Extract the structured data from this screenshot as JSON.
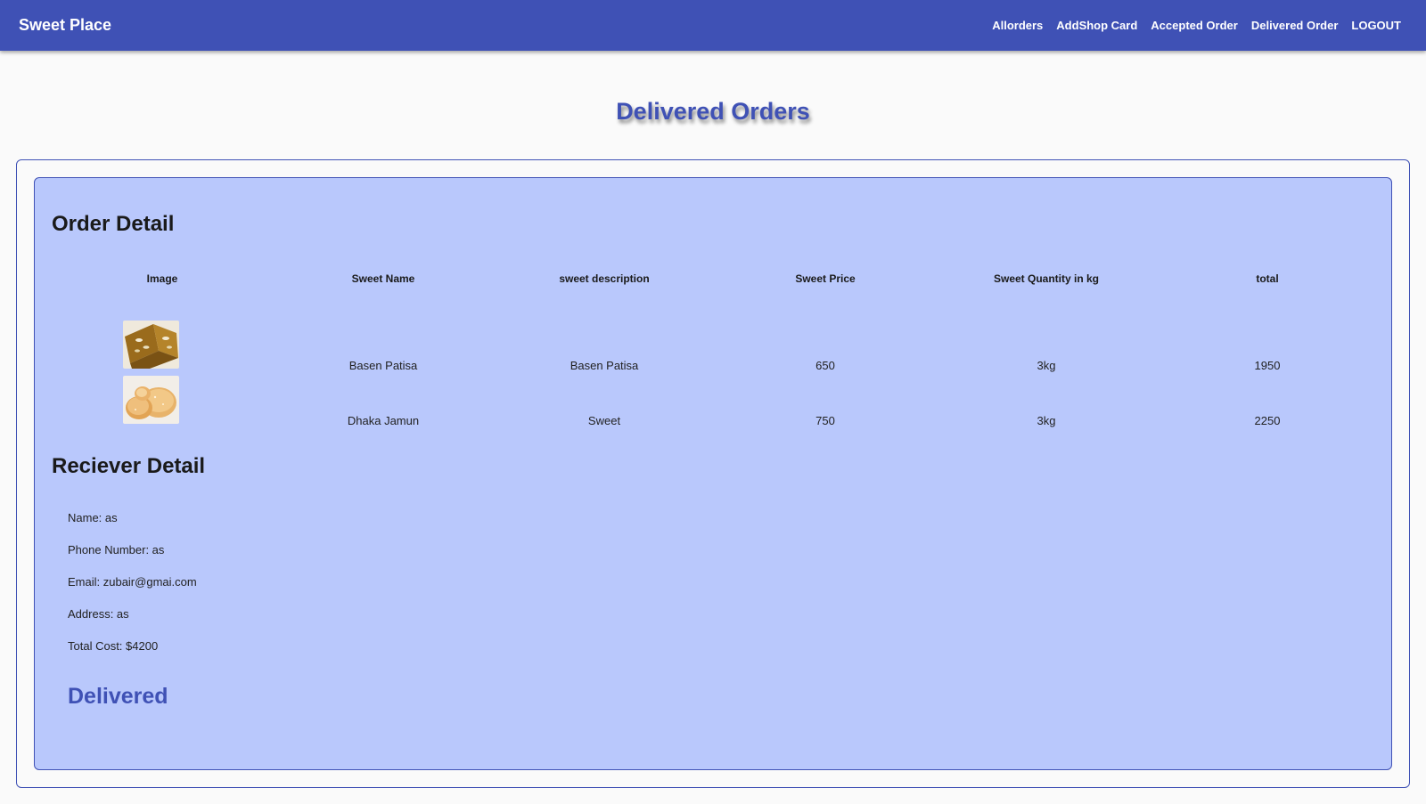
{
  "header": {
    "brand": "Sweet Place",
    "nav": [
      {
        "label": "Allorders"
      },
      {
        "label": "AddShop Card"
      },
      {
        "label": "Accepted Order"
      },
      {
        "label": "Delivered Order"
      },
      {
        "label": "LOGOUT"
      }
    ]
  },
  "page": {
    "title": "Delivered Orders"
  },
  "order": {
    "title": "Order Detail",
    "columns": [
      "Image",
      "Sweet Name",
      "sweet description",
      "Sweet Price",
      "Sweet Quantity in kg",
      "total"
    ],
    "items": [
      {
        "image": "basen-patisa-photo",
        "name": "Basen Patisa",
        "description": "Basen Patisa",
        "price": "650",
        "quantity": "3kg",
        "total": "1950"
      },
      {
        "image": "dhaka-jamun-photo",
        "name": "Dhaka Jamun",
        "description": "Sweet",
        "price": "750",
        "quantity": "3kg",
        "total": "2250"
      }
    ]
  },
  "receiver": {
    "title": "Reciever Detail",
    "name": "Name: as",
    "phone": "Phone Number: as",
    "email": "Email: zubair@gmai.com",
    "address": "Address: as",
    "total_cost": "Total Cost: $4200"
  },
  "status": "Delivered"
}
